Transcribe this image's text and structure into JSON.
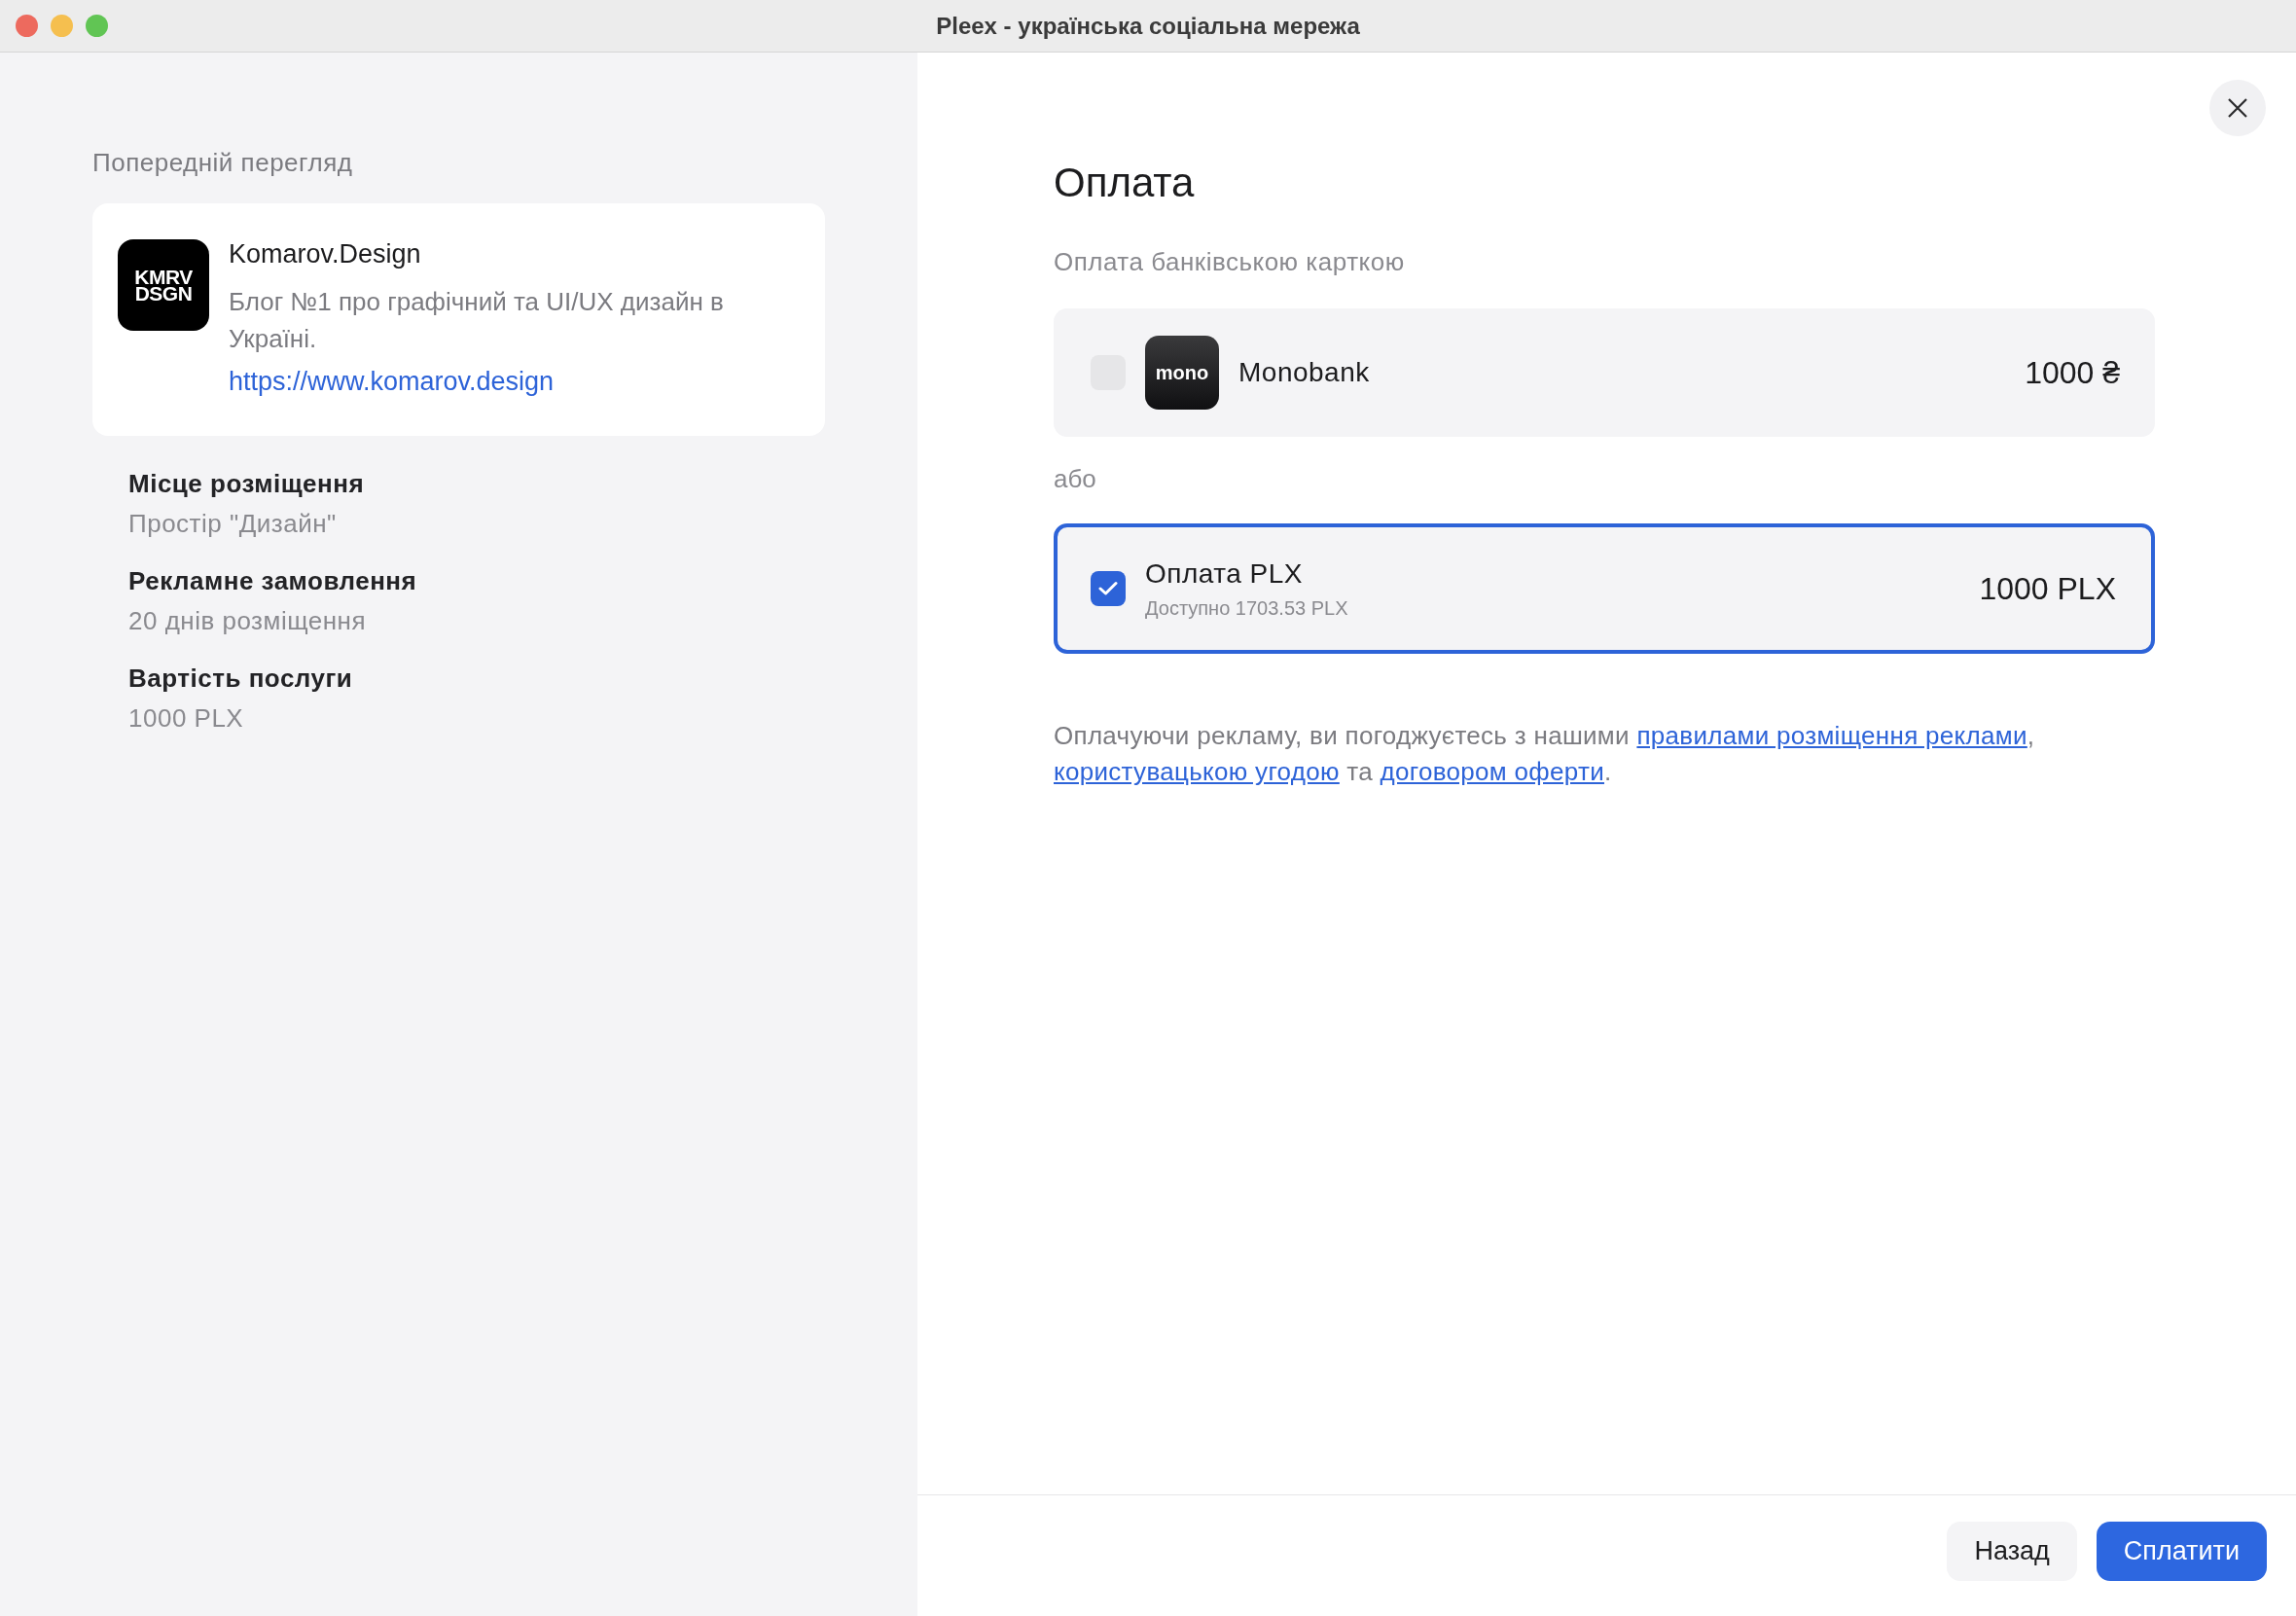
{
  "window": {
    "title": "Pleex - українська соціальна мережа"
  },
  "preview": {
    "heading": "Попередній перегляд",
    "card": {
      "logo_lines": [
        "KMRV",
        "DSGN"
      ],
      "name": "Komarov.Design",
      "description": "Блог №1 про графічний та UI/UX дизайн в Україні.",
      "link": "https://www.komarov.design"
    },
    "details": [
      {
        "label": "Місце розміщення",
        "value": "Простір \"Дизайн\""
      },
      {
        "label": "Рекламне замовлення",
        "value": "20 днів розміщення"
      },
      {
        "label": "Вартість послуги",
        "value": "1000 PLX"
      }
    ]
  },
  "payment": {
    "title": "Оплата",
    "subtitle": "Оплата банківською карткою",
    "separator": "або",
    "options": [
      {
        "kind": "bank",
        "logo_text": "mono",
        "name": "Monobank",
        "amount": "1000 ₴",
        "selected": false
      },
      {
        "kind": "balance",
        "name": "Оплата PLX",
        "note": "Доступно 1703.53 PLX",
        "amount": "1000 PLX",
        "selected": true
      }
    ],
    "terms": [
      {
        "text": "Оплачуючи рекламу, ви погоджуєтесь з нашими ",
        "link": false
      },
      {
        "text": "правилами розміщення реклами",
        "link": true
      },
      {
        "text": ", ",
        "link": false
      },
      {
        "text": "користувацькою угодою",
        "link": true
      },
      {
        "text": " та ",
        "link": false
      },
      {
        "text": "договором оферти",
        "link": true
      },
      {
        "text": ".",
        "link": false
      }
    ]
  },
  "footer": {
    "buttons": [
      {
        "kind": "secondary",
        "label": "Назад"
      },
      {
        "kind": "primary",
        "label": "Сплатити"
      }
    ]
  }
}
